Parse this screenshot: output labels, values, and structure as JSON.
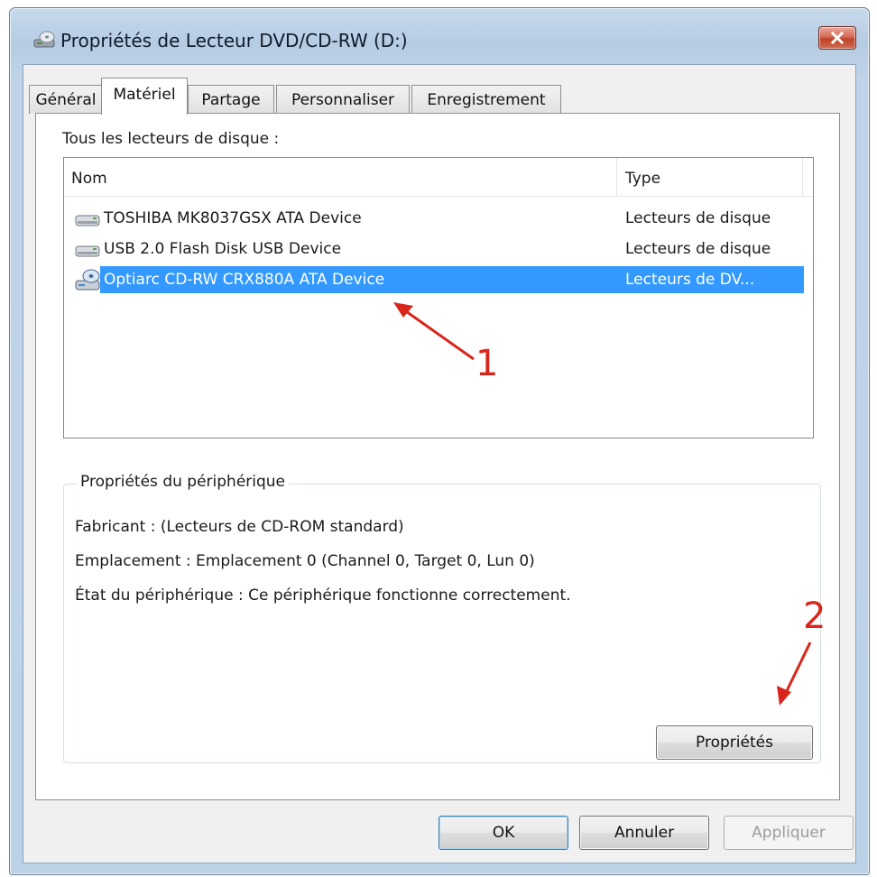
{
  "window": {
    "title": "Propriétés de Lecteur DVD/CD-RW (D:)"
  },
  "tabs": [
    {
      "label": "Général",
      "active": false
    },
    {
      "label": "Matériel",
      "active": true
    },
    {
      "label": "Partage",
      "active": false
    },
    {
      "label": "Personnaliser",
      "active": false
    },
    {
      "label": "Enregistrement",
      "active": false
    }
  ],
  "list": {
    "caption": "Tous les lecteurs de disque :",
    "columns": [
      "Nom",
      "Type"
    ],
    "rows": [
      {
        "name": "TOSHIBA MK8037GSX ATA Device",
        "type": "Lecteurs de disque",
        "icon": "hard-drive-icon",
        "selected": false
      },
      {
        "name": "USB 2.0 Flash Disk USB Device",
        "type": "Lecteurs de disque",
        "icon": "hard-drive-icon",
        "selected": false
      },
      {
        "name": "Optiarc CD-RW CRX880A ATA Device",
        "type": "Lecteurs de DV...",
        "icon": "optical-drive-icon",
        "selected": true
      }
    ]
  },
  "device_properties": {
    "label": "Propriétés du périphérique",
    "manufacturer": "Fabricant : (Lecteurs de CD-ROM standard)",
    "location": "Emplacement : Emplacement 0 (Channel 0, Target 0, Lun 0)",
    "status": "État du périphérique : Ce périphérique fonctionne correctement.",
    "properties_button": "Propriétés"
  },
  "buttons": {
    "ok": "OK",
    "cancel": "Annuler",
    "apply": "Appliquer"
  },
  "annotations": {
    "marker_1": "1",
    "marker_2": "2"
  },
  "colors": {
    "selection": "#3399ff",
    "annotation": "#d9261c",
    "close_button": "#c7432a"
  }
}
